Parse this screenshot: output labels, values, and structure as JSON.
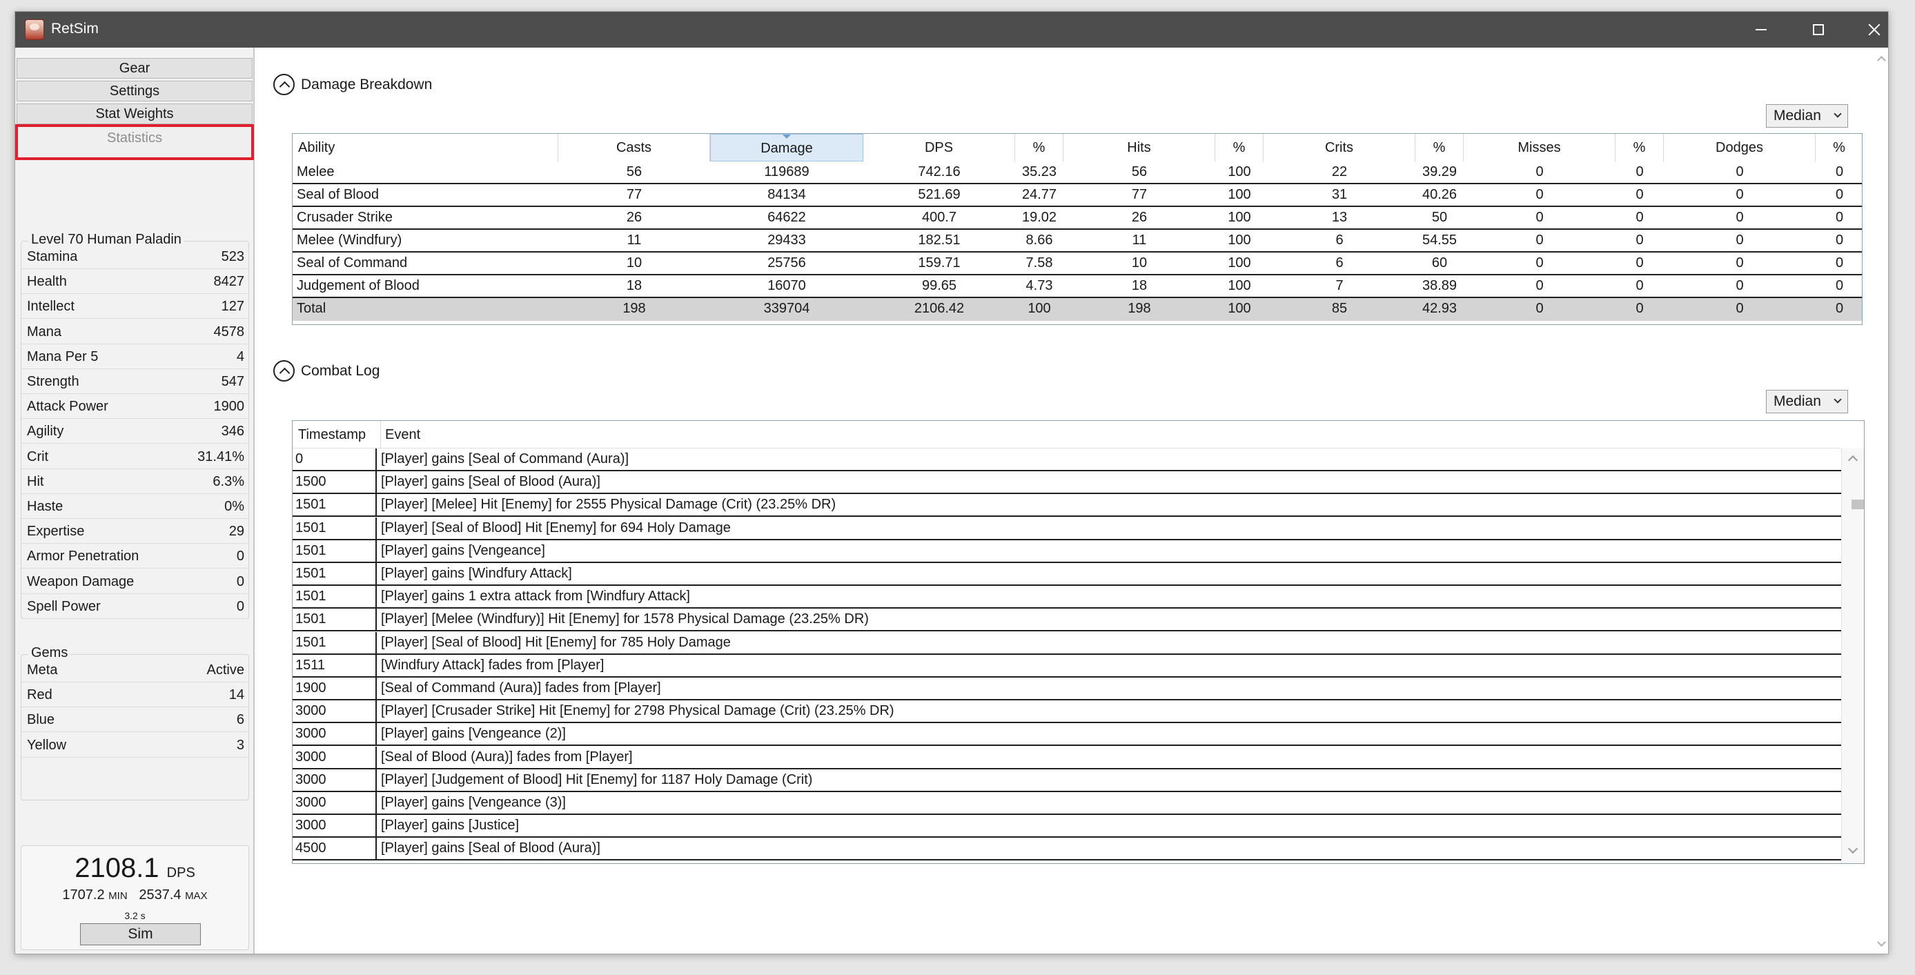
{
  "window": {
    "title": "RetSim"
  },
  "nav": {
    "gear": "Gear",
    "settings": "Settings",
    "stat_weights": "Stat Weights",
    "statistics": "Statistics"
  },
  "character": {
    "title": "Level 70 Human Paladin",
    "stats": [
      {
        "k": "Stamina",
        "v": "523"
      },
      {
        "k": "Health",
        "v": "8427"
      },
      {
        "k": "Intellect",
        "v": "127"
      },
      {
        "k": "Mana",
        "v": "4578"
      },
      {
        "k": "Mana Per 5",
        "v": "4"
      },
      {
        "k": "Strength",
        "v": "547"
      },
      {
        "k": "Attack Power",
        "v": "1900"
      },
      {
        "k": "Agility",
        "v": "346"
      },
      {
        "k": "Crit",
        "v": "31.41%"
      },
      {
        "k": "Hit",
        "v": "6.3%"
      },
      {
        "k": "Haste",
        "v": "0%"
      },
      {
        "k": "Expertise",
        "v": "29"
      },
      {
        "k": "Armor Penetration",
        "v": "0"
      },
      {
        "k": "Weapon Damage",
        "v": "0"
      },
      {
        "k": "Spell Power",
        "v": "0"
      }
    ]
  },
  "gems": {
    "title": "Gems",
    "rows": [
      {
        "k": "Meta",
        "v": "Active"
      },
      {
        "k": "Red",
        "v": "14"
      },
      {
        "k": "Blue",
        "v": "6"
      },
      {
        "k": "Yellow",
        "v": "3"
      }
    ]
  },
  "result": {
    "dps": "2108.1",
    "dps_unit": "DPS",
    "min": "1707.2",
    "min_unit": "MIN",
    "max": "2537.4",
    "max_unit": "MAX",
    "time": "3.2 s",
    "sim_label": "Sim"
  },
  "breakdown": {
    "title": "Damage Breakdown",
    "dropdown": "Median",
    "columns": [
      "Ability",
      "Casts",
      "Damage",
      "DPS",
      "%",
      "Hits",
      "%",
      "Crits",
      "%",
      "Misses",
      "%",
      "Dodges",
      "%"
    ],
    "rows": [
      [
        "Melee",
        "56",
        "119689",
        "742.16",
        "35.23",
        "56",
        "100",
        "22",
        "39.29",
        "0",
        "0",
        "0",
        "0"
      ],
      [
        "Seal of Blood",
        "77",
        "84134",
        "521.69",
        "24.77",
        "77",
        "100",
        "31",
        "40.26",
        "0",
        "0",
        "0",
        "0"
      ],
      [
        "Crusader Strike",
        "26",
        "64622",
        "400.7",
        "19.02",
        "26",
        "100",
        "13",
        "50",
        "0",
        "0",
        "0",
        "0"
      ],
      [
        "Melee (Windfury)",
        "11",
        "29433",
        "182.51",
        "8.66",
        "11",
        "100",
        "6",
        "54.55",
        "0",
        "0",
        "0",
        "0"
      ],
      [
        "Seal of Command",
        "10",
        "25756",
        "159.71",
        "7.58",
        "10",
        "100",
        "6",
        "60",
        "0",
        "0",
        "0",
        "0"
      ],
      [
        "Judgement of Blood",
        "18",
        "16070",
        "99.65",
        "4.73",
        "18",
        "100",
        "7",
        "38.89",
        "0",
        "0",
        "0",
        "0"
      ]
    ],
    "total": [
      "Total",
      "198",
      "339704",
      "2106.42",
      "100",
      "198",
      "100",
      "85",
      "42.93",
      "0",
      "0",
      "0",
      "0"
    ]
  },
  "combat_log": {
    "title": "Combat Log",
    "dropdown": "Median",
    "columns": [
      "Timestamp",
      "Event"
    ],
    "rows": [
      [
        "0",
        "[Player] gains [Seal of Command (Aura)]"
      ],
      [
        "1500",
        "[Player] gains [Seal of Blood (Aura)]"
      ],
      [
        "1501",
        "[Player] [Melee] Hit [Enemy] for 2555 Physical Damage (Crit) (23.25% DR)"
      ],
      [
        "1501",
        "[Player] [Seal of Blood] Hit [Enemy] for 694 Holy Damage"
      ],
      [
        "1501",
        "[Player] gains [Vengeance]"
      ],
      [
        "1501",
        "[Player] gains [Windfury Attack]"
      ],
      [
        "1501",
        "[Player] gains 1 extra attack from [Windfury Attack]"
      ],
      [
        "1501",
        "[Player] [Melee (Windfury)] Hit [Enemy] for 1578 Physical Damage (23.25% DR)"
      ],
      [
        "1501",
        "[Player] [Seal of Blood] Hit [Enemy] for 785 Holy Damage"
      ],
      [
        "1511",
        "[Windfury Attack] fades from [Player]"
      ],
      [
        "1900",
        "[Seal of Command (Aura)] fades from [Player]"
      ],
      [
        "3000",
        "[Player] [Crusader Strike] Hit [Enemy] for 2798 Physical Damage (Crit) (23.25% DR)"
      ],
      [
        "3000",
        "[Player] gains [Vengeance (2)]"
      ],
      [
        "3000",
        "[Seal of Blood (Aura)] fades from [Player]"
      ],
      [
        "3000",
        "[Player] [Judgement of Blood] Hit [Enemy] for 1187 Holy Damage (Crit)"
      ],
      [
        "3000",
        "[Player] gains [Vengeance (3)]"
      ],
      [
        "3000",
        "[Player] gains [Justice]"
      ],
      [
        "4500",
        "[Player] gains [Seal of Blood (Aura)]"
      ]
    ]
  }
}
